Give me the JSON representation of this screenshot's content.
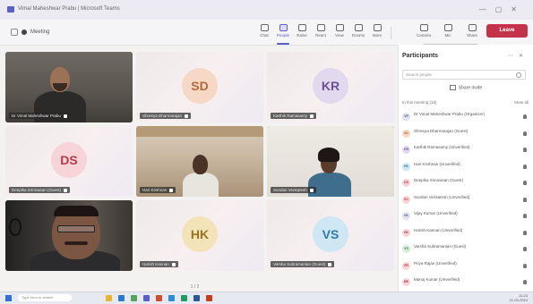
{
  "window": {
    "title": "Vimal Maheshwar Prabu | Microsoft Teams",
    "controls": [
      "—",
      "▢",
      "✕"
    ]
  },
  "meeting": {
    "title": "Meeting"
  },
  "toolbar": {
    "buttons": [
      {
        "label": "Chat",
        "icon": "chat-icon"
      },
      {
        "label": "People",
        "icon": "people-icon",
        "active": true
      },
      {
        "label": "Raise",
        "icon": "raise-hand-icon"
      },
      {
        "label": "React",
        "icon": "react-icon"
      },
      {
        "label": "View",
        "icon": "view-icon"
      },
      {
        "label": "Rooms",
        "icon": "rooms-icon"
      },
      {
        "label": "More",
        "icon": "more-icon"
      },
      {
        "label": "Camera",
        "icon": "camera-icon"
      },
      {
        "label": "Mic",
        "icon": "mic-icon"
      },
      {
        "label": "Share",
        "icon": "share-icon"
      }
    ],
    "leave_label": "Leave",
    "tooltip": "Share content in the meeting"
  },
  "tiles": [
    {
      "type": "video",
      "name": "Dr Vimal Maheshwar Prabu",
      "scene": "man-bald"
    },
    {
      "type": "initials",
      "initials": "SD",
      "name": "Shreeya Dharmarajan",
      "avatar_bg": "#f6d8c6",
      "avatar_fg": "#b36a3c"
    },
    {
      "type": "initials",
      "initials": "KR",
      "name": "Karthik Ramasamy",
      "avatar_bg": "#e3d9ef",
      "avatar_fg": "#6b5196"
    },
    {
      "type": "initials",
      "initials": "DS",
      "name": "Deepika Srinivasan (Guest)",
      "avatar_bg": "#f6d4d8",
      "avatar_fg": "#b23a4d"
    },
    {
      "type": "video",
      "name": "Hari Krishnan",
      "scene": "man-room"
    },
    {
      "type": "video",
      "name": "Sundari Venkatesh",
      "scene": "woman"
    },
    {
      "type": "video",
      "name": "Vijay Kumar",
      "scene": "man-glasses"
    },
    {
      "type": "initials",
      "initials": "HK",
      "name": "Harish Kannan",
      "avatar_bg": "#f3e3b8",
      "avatar_fg": "#9a7220"
    },
    {
      "type": "initials",
      "initials": "VS",
      "name": "Varsha Subramanian (Guest)",
      "avatar_bg": "#cfe6f3",
      "avatar_fg": "#2f7aa6"
    }
  ],
  "pager": "1 / 2",
  "panel": {
    "title": "Participants",
    "actions": [
      "⋯",
      "✕"
    ],
    "search_placeholder": "Search people",
    "share_label": "Share invite",
    "section_label": "In this meeting (19)",
    "section_right": "Mute all",
    "participants": [
      {
        "name": "Dr Vimal Maheshwar Prabu (Organizer)",
        "initials": "VP",
        "bg": "#dfe3f0",
        "fg": "#4a5a8a"
      },
      {
        "name": "Shreeya Dharmarajan (Guest)",
        "initials": "SD",
        "bg": "#f6d8c6",
        "fg": "#b36a3c"
      },
      {
        "name": "Karthik Ramasamy (Unverified)",
        "initials": "KR",
        "bg": "#e3d9ef",
        "fg": "#6b5196"
      },
      {
        "name": "Hari Krishnan (Unverified)",
        "initials": "HK",
        "bg": "#cfe6f3",
        "fg": "#2f7aa6"
      },
      {
        "name": "Deepika Srinivasan (Guest)",
        "initials": "DS",
        "bg": "#f6d4d8",
        "fg": "#b23a4d"
      },
      {
        "name": "Sundari Venkatesh (Unverified)",
        "initials": "SV",
        "bg": "#f6d4d8",
        "fg": "#b23a4d"
      },
      {
        "name": "Vijay Kumar (Unverified)",
        "initials": "VK",
        "bg": "#dfe3f0",
        "fg": "#4a5a8a"
      },
      {
        "name": "Harish Kannan (Unverified)",
        "initials": "HK",
        "bg": "#f6d4d8",
        "fg": "#b23a4d"
      },
      {
        "name": "Varsha Subramanian (Guest)",
        "initials": "VS",
        "bg": "#d8ecdc",
        "fg": "#3f7f4f"
      },
      {
        "name": "Priya Rajan (Unverified)",
        "initials": "PR",
        "bg": "#f6d4d8",
        "fg": "#b23a4d"
      },
      {
        "name": "Manoj Kumar (Unverified)",
        "initials": "MK",
        "bg": "#f6d4d8",
        "fg": "#b23a4d"
      }
    ]
  },
  "taskbar": {
    "search_placeholder": "Type here to search",
    "time": "11:24",
    "date": "21-03-2024"
  }
}
